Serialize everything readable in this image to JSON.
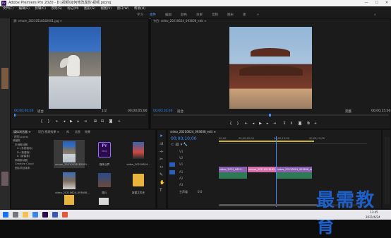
{
  "window": {
    "title": "Adobe Premiere Pro 2020 - D:\\视频\\如何修改属性\\视频.prproj",
    "controls": [
      "—",
      "☐",
      "✕"
    ]
  },
  "menu": [
    "文件(F)",
    "编辑(E)",
    "剪辑(C)",
    "序列(S)",
    "标记(M)",
    "图形(G)",
    "视图(V)",
    "窗口(W)",
    "帮助(H)"
  ],
  "workspaces": [
    "学习",
    "组件",
    "编辑",
    "颜色",
    "效果",
    "音频",
    "图形",
    "库"
  ],
  "workspaces_active": 1,
  "source_monitor": {
    "tab": "源: vmum_20210518182001.jpg ≡",
    "timecode_left": "00;00;00;00",
    "fit": "适合",
    "ratio": "1/2",
    "timecode_right": "00;00;05;00"
  },
  "program_monitor": {
    "tab": "节目: video_20210624_093608_edit ≡",
    "timecode_left": "00;00;10;00",
    "fit": "适合",
    "ratio": "完整",
    "timecode_right": "00;00;15;00"
  },
  "project_panel": {
    "tabs": [
      "媒体浏览器 ≡",
      "项目:视频效果 ≡",
      "库",
      "信息",
      "效果"
    ],
    "path": "视频.prproj",
    "tree": [
      "收藏夹",
      "本地驱动器",
      "C: (系统驱动)",
      "D: (新建卷)",
      "E: (新建卷)",
      "网络驱动器",
      "Creative Cloud",
      "团队项目版本"
    ],
    "items": [
      {
        "label": "vmum_20210518182001...",
        "kind": "photo"
      },
      {
        "label": "媒体业界",
        "kind": "pr"
      },
      {
        "label": "video_20210624...",
        "kind": "photo2"
      },
      {
        "label": "video_20210624_093608...",
        "kind": "photo"
      },
      {
        "label": "图片",
        "kind": "folder"
      },
      {
        "label": "新建文件夹",
        "kind": "folder"
      }
    ],
    "pr_icon_text": "Pr",
    "pr_icon_sub": "PROJ"
  },
  "timeline": {
    "tab": "video_20210624_093608_edit ≡",
    "timecode": "00;00;10;00",
    "ruler": [
      "00;00",
      "00;00;05;00",
      "00;00;10;00",
      "00;00;15;00"
    ],
    "tracks": [
      "V3",
      "V2",
      "V1",
      "A1",
      "A2",
      "A3"
    ],
    "master": "主声道",
    "master_value": "0.0",
    "clips": [
      {
        "label": "video_2021_0624...",
        "color": "#8a5fb0"
      },
      {
        "label": "vmum_20210518182...",
        "color": "#d46fa8"
      },
      {
        "label": "video_20210624_093608_edit",
        "color": "#8a5fb0"
      }
    ]
  },
  "taskbar": {
    "time": "13:45",
    "date": "2021/6/24"
  },
  "watermark": "最需教育"
}
